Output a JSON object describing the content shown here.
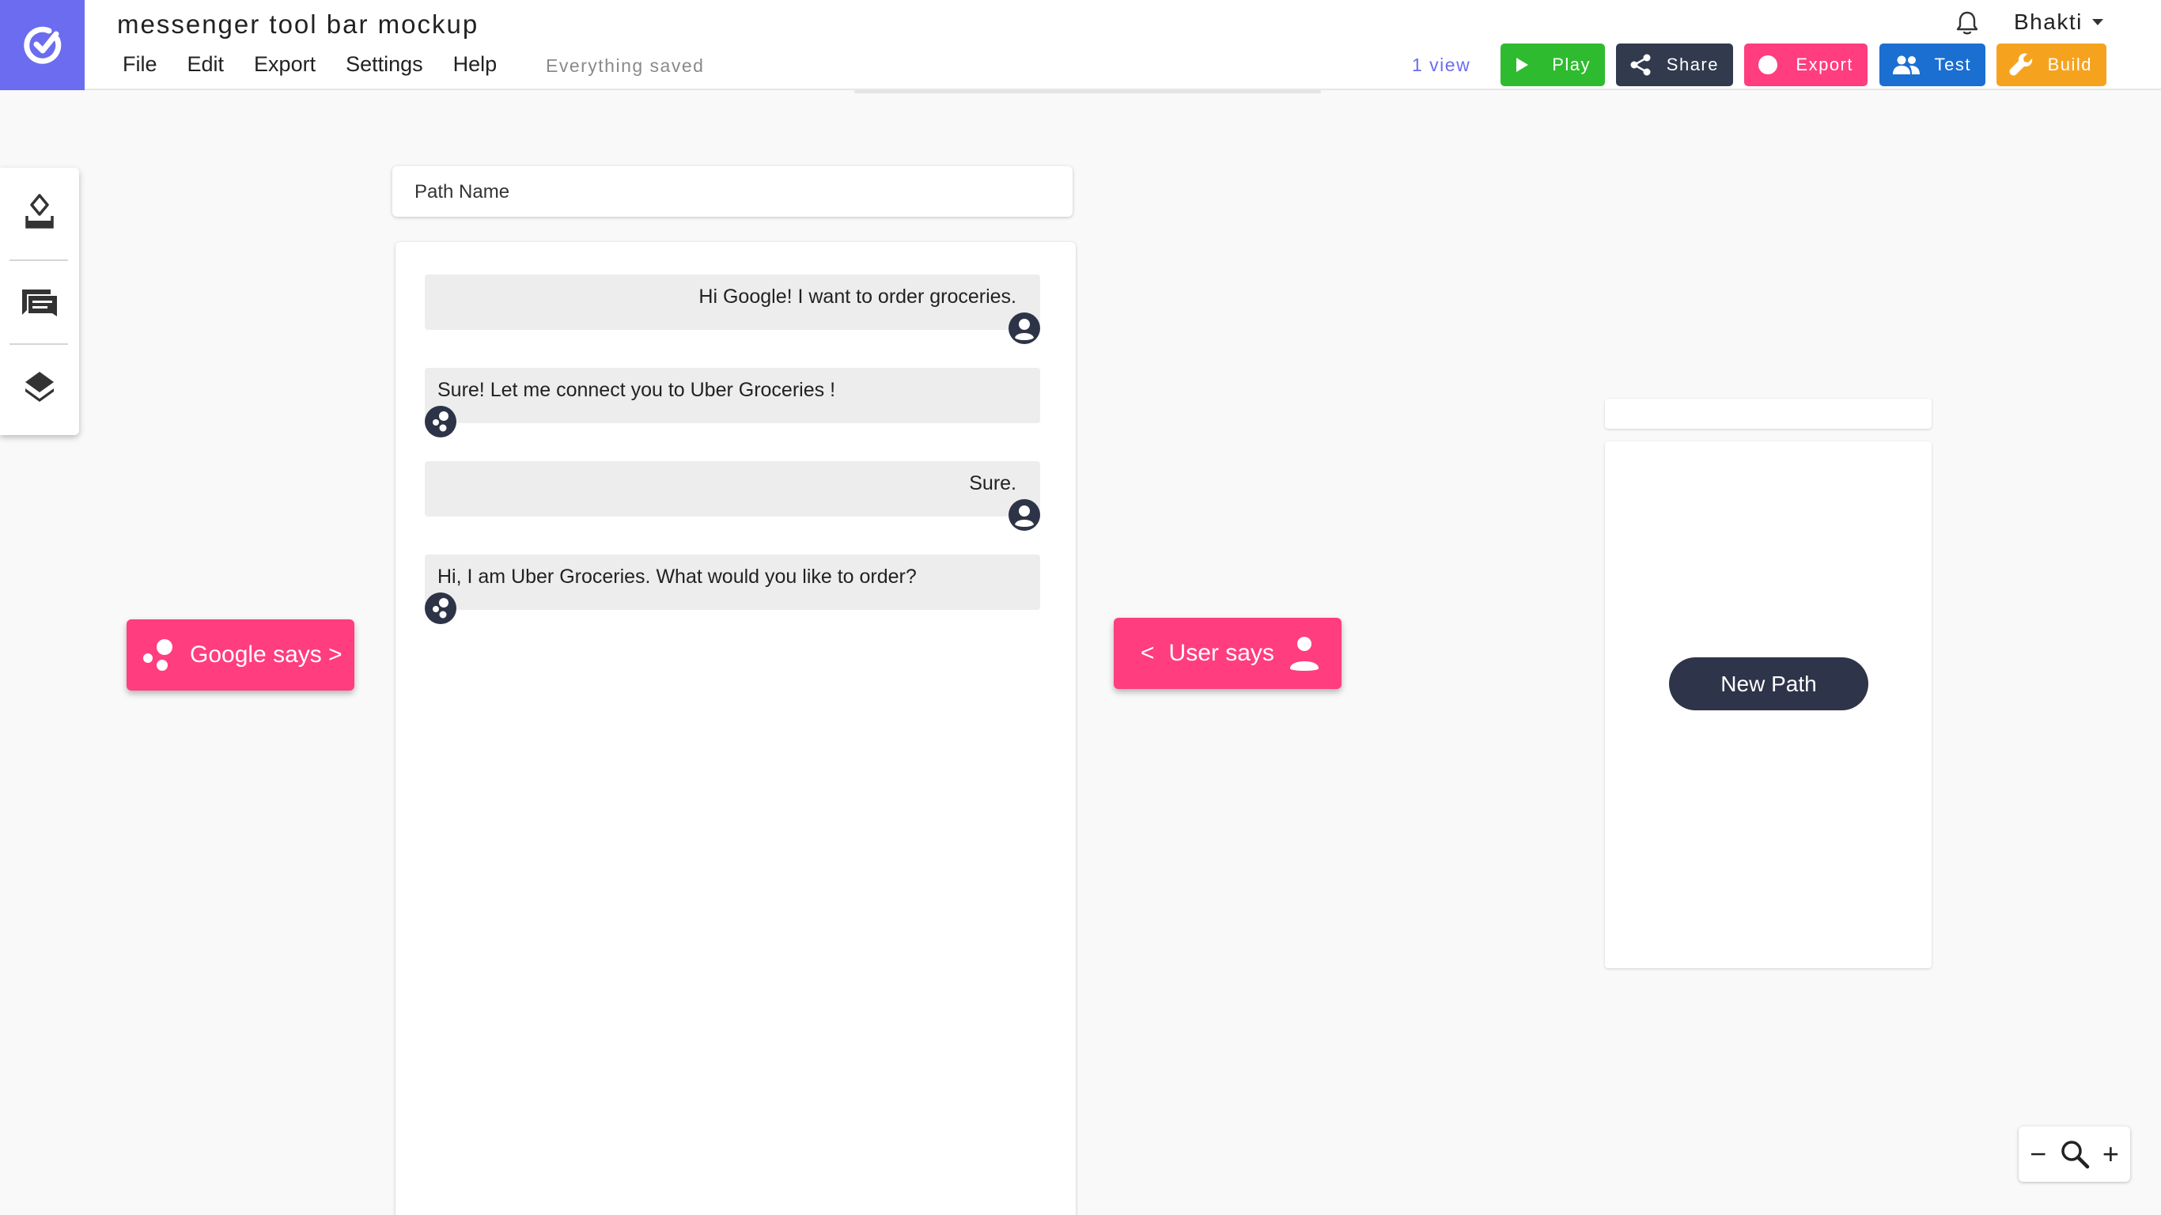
{
  "app": {
    "title": "messenger tool bar mockup",
    "save_status": "Everything saved",
    "views": "1 view",
    "user": "Bhakti"
  },
  "menu": {
    "items": [
      "File",
      "Edit",
      "Export",
      "Settings",
      "Help"
    ]
  },
  "toolbar": {
    "play": "Play",
    "share": "Share",
    "export": "Export",
    "test": "Test",
    "build": "Build"
  },
  "icons": {
    "logo": "check-circle-logo",
    "play": "play-icon",
    "share": "share-icon",
    "export": "record-dot-icon",
    "test": "people-icon",
    "build": "wrench-icon",
    "notifications": "bell-icon",
    "user_menu": "chevron-down-icon",
    "tools": [
      "eraser-icon",
      "chat-icon",
      "layers-icon"
    ],
    "user_avatar": "user-avatar-icon",
    "assistant_avatar": "assistant-dots-icon",
    "zoom": "search-icon"
  },
  "path": {
    "name_placeholder": "Path Name"
  },
  "conversation": [
    {
      "speaker": "user",
      "text": "Hi Google! I want to order groceries."
    },
    {
      "speaker": "assistant",
      "text": "Sure! Let me connect you to Uber Groceries !"
    },
    {
      "speaker": "user",
      "text": "Sure."
    },
    {
      "speaker": "assistant",
      "text": "Hi, I am Uber Groceries. What would you like to order?"
    }
  ],
  "actions": {
    "google_says": "Google says >",
    "user_says_prefix": "<",
    "user_says": "User says",
    "new_path": "New Path"
  },
  "zoom": {
    "out": "−",
    "in": "+"
  },
  "colors": {
    "brand": "#6b6cf0",
    "play": "#2fbb2f",
    "share": "#323a4e",
    "export": "#ff3d7f",
    "test": "#1a6fd1",
    "build": "#f5a31f",
    "pink_action": "#ff3d7f",
    "dark": "#2e3449"
  }
}
